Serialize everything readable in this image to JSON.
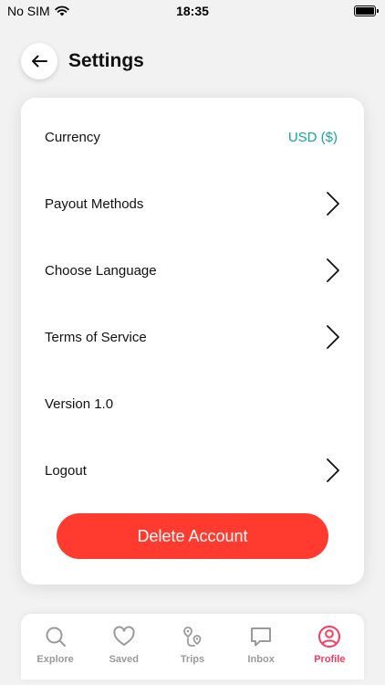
{
  "status_bar": {
    "carrier": "No SIM",
    "time": "18:35"
  },
  "header": {
    "title": "Settings",
    "back_icon": "arrow-left-icon"
  },
  "settings": {
    "rows": [
      {
        "label": "Currency",
        "value": "USD ($)",
        "chevron": false
      },
      {
        "label": "Payout Methods",
        "value": "",
        "chevron": true
      },
      {
        "label": "Choose Language",
        "value": "",
        "chevron": true
      },
      {
        "label": "Terms of Service",
        "value": "",
        "chevron": true
      },
      {
        "label": "Version 1.0",
        "value": "",
        "chevron": false
      },
      {
        "label": "Logout",
        "value": "",
        "chevron": true
      }
    ],
    "delete_label": "Delete Account"
  },
  "tab_bar": {
    "tabs": [
      {
        "label": "Explore",
        "icon": "search-icon",
        "active": false
      },
      {
        "label": "Saved",
        "icon": "heart-icon",
        "active": false
      },
      {
        "label": "Trips",
        "icon": "route-pin-icon",
        "active": false
      },
      {
        "label": "Inbox",
        "icon": "chat-bubble-icon",
        "active": false
      },
      {
        "label": "Profile",
        "icon": "user-circle-icon",
        "active": true
      }
    ]
  },
  "colors": {
    "accent_teal": "#1aa3a3",
    "delete_red": "#ff3b30",
    "active_tab": "#ff385c",
    "inactive_tab": "#9a9a9a"
  }
}
